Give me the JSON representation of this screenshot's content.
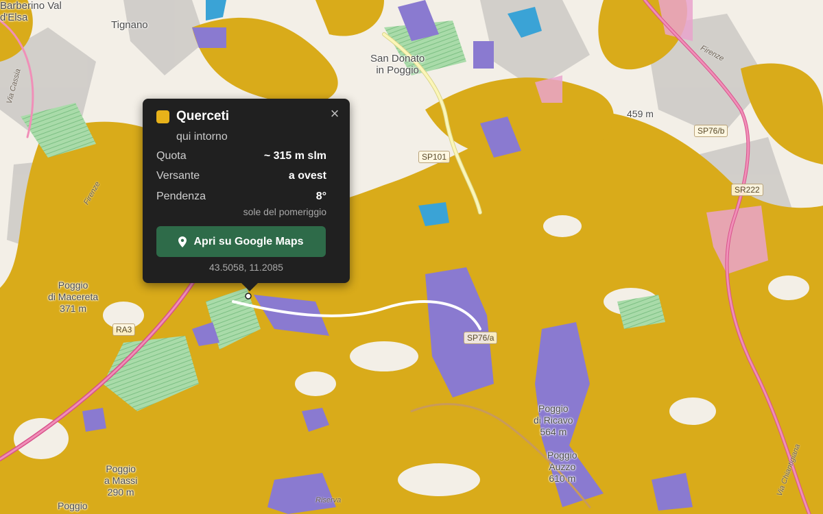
{
  "map": {
    "colors": {
      "background": "#f3efe7",
      "oak_woods": "#d9ab1a",
      "lavender_zone": "#8a7ad0",
      "vineyard": "#96d49a",
      "water": "#3aa3d6",
      "urban_pink": "#e9a3cc",
      "hillshade": "#bdbdbd",
      "road": "#fbf6b8"
    },
    "places": [
      {
        "id": "barberino",
        "label_1": "Barberino Val",
        "label_2": "d'Elsa"
      },
      {
        "id": "tignano",
        "label_1": "Tignano"
      },
      {
        "id": "san-donato",
        "label_1": "San Donato",
        "label_2": "in Poggio"
      },
      {
        "id": "poggio-macereta",
        "label_1": "Poggio",
        "label_2": "di Macereta",
        "label_3": "371 m"
      },
      {
        "id": "poggio-massi",
        "label_1": "Poggio",
        "label_2": "a Massi",
        "label_3": "290 m"
      },
      {
        "id": "poggio-bottom",
        "label_1": "Poggio"
      },
      {
        "id": "poggio-ricavo",
        "label_1": "Poggio",
        "label_2": "di Ricavo",
        "label_3": "564 m"
      },
      {
        "id": "poggio-auzzo",
        "label_1": "Poggio",
        "label_2": "Auzzo",
        "label_3": "610 m"
      },
      {
        "id": "peak-top",
        "label_1": "459 m"
      }
    ],
    "road_shields": [
      "SP101",
      "SP76/a",
      "SP76/b",
      "SR222",
      "RA3"
    ],
    "road_labels": [
      "Via Cassia",
      "Firenze",
      "Firenze",
      "Via Chiantigiana",
      "Riserva"
    ]
  },
  "popup": {
    "title": "Querceti",
    "subtitle": "qui intorno",
    "swatch_color": "#e8b21a",
    "close_label": "×",
    "rows": [
      {
        "label": "Quota",
        "value": "~ 315 m slm"
      },
      {
        "label": "Versante",
        "value": "a ovest"
      },
      {
        "label": "Pendenza",
        "value": "8°"
      }
    ],
    "note": "sole del pomeriggio",
    "button_label": "Apri su Google Maps",
    "coordinates": "43.5058, 11.2085"
  }
}
